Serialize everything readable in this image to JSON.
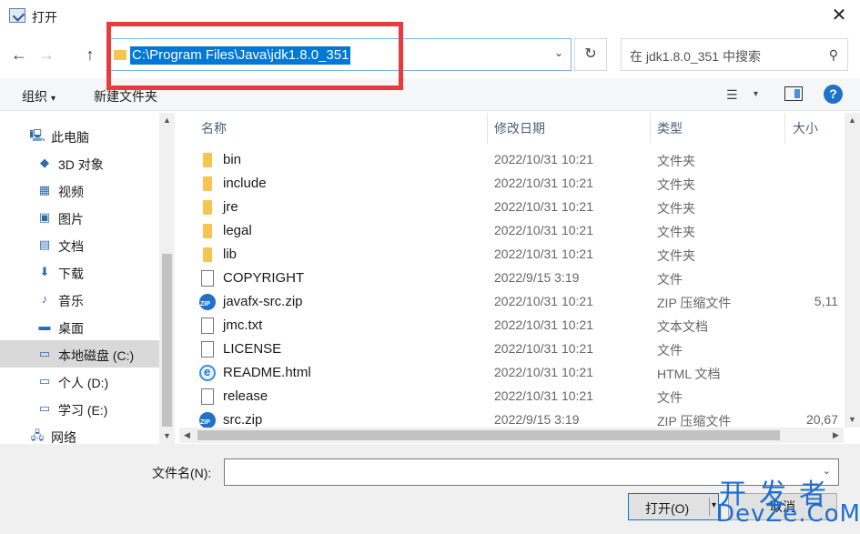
{
  "window": {
    "title": "打开",
    "close_glyph": "✕"
  },
  "nav": {
    "back_glyph": "←",
    "forward_glyph": "→",
    "up_glyph": "↑",
    "address": "C:\\Program Files\\Java\\jdk1.8.0_351",
    "address_dropdown_glyph": "⌄",
    "refresh_glyph": "↻",
    "search_placeholder": "在 jdk1.8.0_351 中搜索",
    "search_glyph": "⚲"
  },
  "toolbar": {
    "organize_label": "组织",
    "organize_caret": "▾",
    "new_folder_label": "新建文件夹",
    "view_glyph": "☰",
    "view_caret": "▾",
    "help_glyph": "?"
  },
  "sidebar": {
    "items": [
      {
        "label": "此电脑",
        "icon": "computer-icon",
        "glyph": "🖳",
        "selected": false
      },
      {
        "label": "3D 对象",
        "icon": "3d-objects-icon",
        "glyph": "◆",
        "selected": false
      },
      {
        "label": "视频",
        "icon": "video-icon",
        "glyph": "▦",
        "selected": false
      },
      {
        "label": "图片",
        "icon": "pictures-icon",
        "glyph": "▣",
        "selected": false
      },
      {
        "label": "文档",
        "icon": "documents-icon",
        "glyph": "▤",
        "selected": false
      },
      {
        "label": "下载",
        "icon": "download-icon",
        "glyph": "⬇",
        "selected": false
      },
      {
        "label": "音乐",
        "icon": "music-icon",
        "glyph": "♪",
        "selected": false
      },
      {
        "label": "桌面",
        "icon": "desktop-icon",
        "glyph": "▬",
        "selected": false
      },
      {
        "label": "本地磁盘 (C:)",
        "icon": "drive-c-icon",
        "glyph": "▭",
        "selected": true
      },
      {
        "label": "个人 (D:)",
        "icon": "drive-d-icon",
        "glyph": "▭",
        "selected": false
      },
      {
        "label": "学习 (E:)",
        "icon": "drive-e-icon",
        "glyph": "▭",
        "selected": false
      },
      {
        "label": "网络",
        "icon": "network-icon",
        "glyph": "🖧",
        "selected": false
      }
    ]
  },
  "columns": {
    "name": "名称",
    "date": "修改日期",
    "type": "类型",
    "size": "大小",
    "sort_glyph": "⌃"
  },
  "files": [
    {
      "name": "bin",
      "date": "2022/10/31 10:21",
      "type": "文件夹",
      "size": "",
      "icon": "folder"
    },
    {
      "name": "include",
      "date": "2022/10/31 10:21",
      "type": "文件夹",
      "size": "",
      "icon": "folder"
    },
    {
      "name": "jre",
      "date": "2022/10/31 10:21",
      "type": "文件夹",
      "size": "",
      "icon": "folder"
    },
    {
      "name": "legal",
      "date": "2022/10/31 10:21",
      "type": "文件夹",
      "size": "",
      "icon": "folder"
    },
    {
      "name": "lib",
      "date": "2022/10/31 10:21",
      "type": "文件夹",
      "size": "",
      "icon": "folder"
    },
    {
      "name": "COPYRIGHT",
      "date": "2022/9/15 3:19",
      "type": "文件",
      "size": "",
      "icon": "doc"
    },
    {
      "name": "javafx-src.zip",
      "date": "2022/10/31 10:21",
      "type": "ZIP 压缩文件",
      "size": "5,11",
      "icon": "zip"
    },
    {
      "name": "jmc.txt",
      "date": "2022/10/31 10:21",
      "type": "文本文档",
      "size": "",
      "icon": "doc"
    },
    {
      "name": "LICENSE",
      "date": "2022/10/31 10:21",
      "type": "文件",
      "size": "",
      "icon": "doc"
    },
    {
      "name": "README.html",
      "date": "2022/10/31 10:21",
      "type": "HTML 文档",
      "size": "",
      "icon": "html"
    },
    {
      "name": "release",
      "date": "2022/10/31 10:21",
      "type": "文件",
      "size": "",
      "icon": "doc"
    },
    {
      "name": "src.zip",
      "date": "2022/9/15 3:19",
      "type": "ZIP 压缩文件",
      "size": "20,67",
      "icon": "zip"
    }
  ],
  "bottom": {
    "filename_label": "文件名(N):",
    "filename_value": "",
    "filename_caret": "⌄",
    "open_label": "打开(O)",
    "open_caret": "▾",
    "cancel_label": "取消"
  },
  "watermark": {
    "top": "开发者",
    "bottom": "DevZe.CoM"
  },
  "colors": {
    "highlight": "#ea3a3a",
    "selection": "#0078d7",
    "folder": "#f8c44f",
    "watermark": "#1e6fd0"
  }
}
